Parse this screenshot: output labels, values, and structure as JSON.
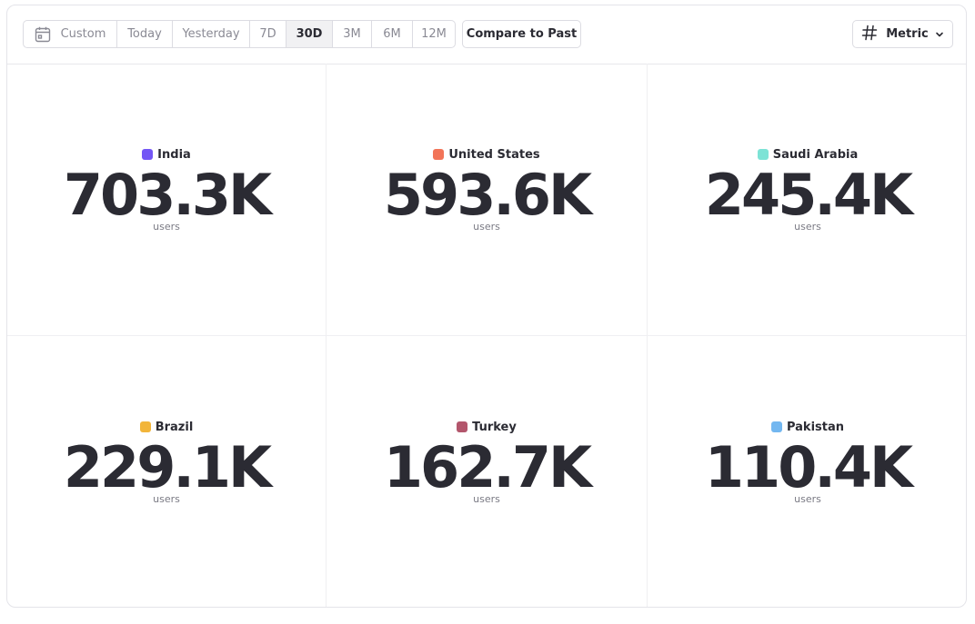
{
  "toolbar": {
    "ranges": [
      {
        "label": "Custom",
        "icon": "calendar-icon"
      },
      {
        "label": "Today"
      },
      {
        "label": "Yesterday"
      },
      {
        "label": "7D"
      },
      {
        "label": "30D",
        "selected": true
      },
      {
        "label": "3M"
      },
      {
        "label": "6M"
      },
      {
        "label": "12M"
      }
    ],
    "compare_label": "Compare to Past",
    "metric_label": "Metric",
    "metric_icon": "hash-icon"
  },
  "metrics": [
    {
      "country": "India",
      "value": "703.3K",
      "unit": "users",
      "color": "#7356f5"
    },
    {
      "country": "United States",
      "value": "593.6K",
      "unit": "users",
      "color": "#f27458"
    },
    {
      "country": "Saudi Arabia",
      "value": "245.4K",
      "unit": "users",
      "color": "#7de3d6"
    },
    {
      "country": "Brazil",
      "value": "229.1K",
      "unit": "users",
      "color": "#f2b53a"
    },
    {
      "country": "Turkey",
      "value": "162.7K",
      "unit": "users",
      "color": "#b3566c"
    },
    {
      "country": "Pakistan",
      "value": "110.4K",
      "unit": "users",
      "color": "#73b7f0"
    }
  ]
}
